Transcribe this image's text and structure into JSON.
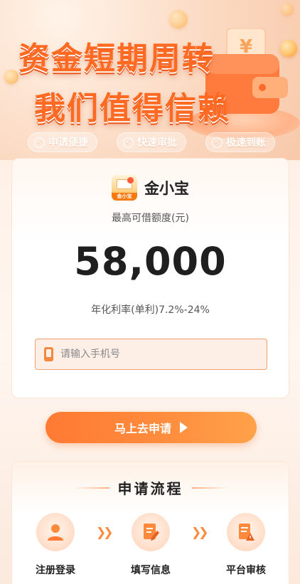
{
  "hero": {
    "line1": "资金短期周转",
    "line2": "我们值得信赖",
    "wallet_symbol": "¥",
    "features": [
      "申请便捷",
      "快速审批",
      "极速到账"
    ]
  },
  "card": {
    "app_name": "金小宝",
    "logo_text": "金小宝",
    "limit_label": "最高可借额度(元)",
    "amount": "58,000",
    "rate_text": "年化利率(单利)7.2%-24%",
    "phone_placeholder": "请输入手机号"
  },
  "cta": {
    "label": "马上去申请"
  },
  "process": {
    "title": "申请流程",
    "steps": [
      "注册登录",
      "填写信息",
      "平台审核"
    ]
  },
  "colors": {
    "accent": "#ff7a32",
    "accent_dark": "#e95417",
    "text": "#222222"
  }
}
